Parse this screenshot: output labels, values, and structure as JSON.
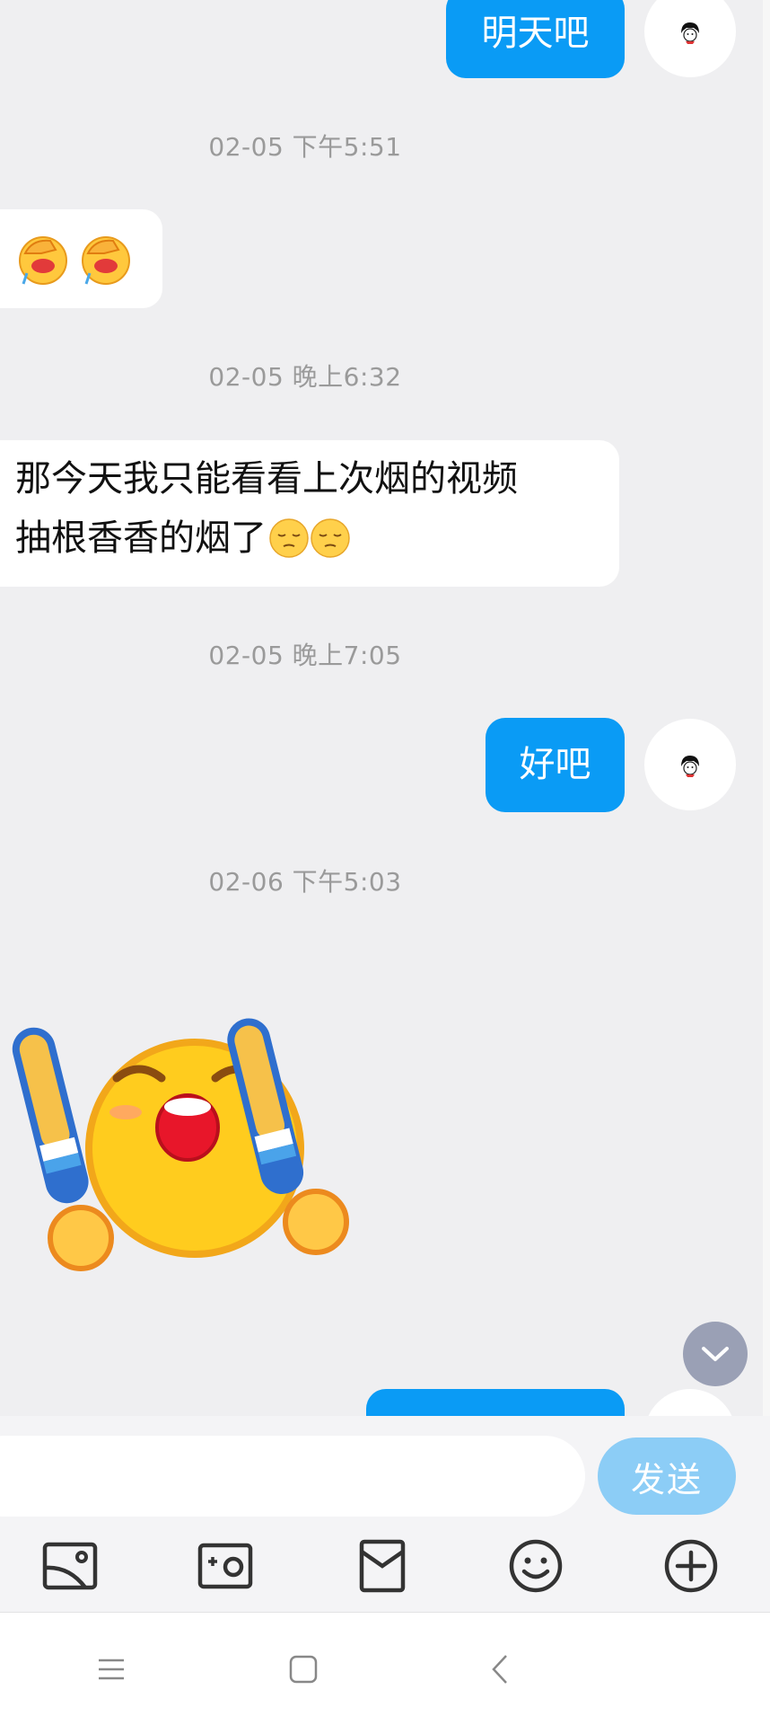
{
  "messages": [
    {
      "id": "m1",
      "direction": "out",
      "text": "明天吧"
    },
    {
      "id": "t1",
      "timestamp": "02-05 下午5:51"
    },
    {
      "id": "m2",
      "direction": "in",
      "emoji": [
        "facepalm-crying-emoji",
        "facepalm-crying-emoji"
      ]
    },
    {
      "id": "t2",
      "timestamp": "02-05 晚上6:32"
    },
    {
      "id": "m3",
      "direction": "in",
      "line1": "那今天我只能看看上次烟的视频",
      "line2": "抽根香香的烟了",
      "emoji": [
        "pensive-emoji",
        "pensive-emoji"
      ]
    },
    {
      "id": "t3",
      "timestamp": "02-05 晚上7:05"
    },
    {
      "id": "m4",
      "direction": "out",
      "text": "好吧"
    },
    {
      "id": "t4",
      "timestamp": "02-06 下午5:03"
    },
    {
      "id": "m5",
      "direction": "in",
      "sticker": "cheering-face-sticker"
    }
  ],
  "composer": {
    "placeholder": "",
    "send_label": "发送"
  },
  "toolbar_icons": [
    "image-icon",
    "camera-icon",
    "red-packet-icon",
    "emoji-icon",
    "plus-icon"
  ],
  "nav_icons": [
    "menu-icon",
    "home-icon",
    "back-icon"
  ],
  "colors": {
    "accent": "#0a9bf5",
    "send_disabled": "#8ccdf6",
    "background": "#efeff1"
  }
}
